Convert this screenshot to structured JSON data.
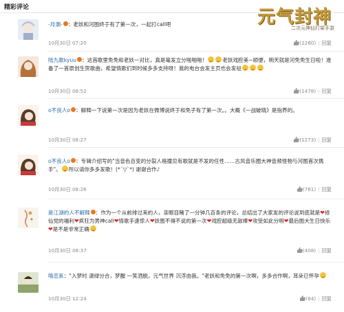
{
  "header": {
    "title": "精彩评论"
  },
  "logo": {
    "main": "元气封神",
    "sub": "二次元神仙打架手游"
  },
  "comments": [
    {
      "user": "-月潮-",
      "text": "老妖和河图终于有了第一次，一起打call吧",
      "time": "10月30日 07:20",
      "likes": "(2260)",
      "reply": "回复"
    },
    {
      "user": "陆九歌kyuu",
      "text1": "这首歌里免免和老妖一对比，真是毫发立分啪啪啪！",
      "text2": "老妖戏腔美~顺便，明天就是河免免生日啦！准备了一首原创生贺歌曲，希望情歌们到时候多多支持呀！我的电台会发主页也会发哒",
      "time": "10月30日 08:52",
      "likes": "(1478)",
      "reply": "回复"
    },
    {
      "user": "o不良人o",
      "text1": "解释一下说第一次是因为老妖在微博说终于和免子有了第一次。。大概《一战破晓》是指养的。",
      "time": "10月30日 08:27",
      "likes": "(1273)",
      "reply": "回复"
    },
    {
      "user": "o不良人o",
      "text1": "专辑介绍写的\"当音色百变的分裂人格撞见有歌就是不发的任性……古风音乐圈大神音频怪物与河图首次携手\"。",
      "text2": "所以请你多多发歌！(*´▽`*) 谢谢合作♪",
      "time": "10月30日 08:26",
      "likes": "(761)",
      "reply": "回复"
    },
    {
      "user": "是江湖的人不解释",
      "text1": "作为一个从前排过来的人，亲眼目睹了一分钟几百条的评论，总结出了大家发的评论说到底就是",
      "text2": "修仙党的福利",
      "text3": "疯狂为男神call",
      "text4": "情歌手速惊人",
      "text5": "妖图不得不说的第一次",
      "text6": "戏腔超级无敌棒",
      "text7": "攻受如此分明",
      "text8": "最后图大生日快乐",
      "text9": "是不是非常正确",
      "time": "10月30日 08:37",
      "likes": "(408)",
      "reply": "回复"
    },
    {
      "user": "嘻恋系",
      "text1": "\"入梦时 潇绿分合，梦醒 一笑洒脱，元气世界 沉浮由我。\"老妖和免免的第一次啊，多多合作啊，耳朵已怀孕",
      "time": "10月30日 12:24",
      "likes": "(64)",
      "reply": "回复"
    }
  ]
}
